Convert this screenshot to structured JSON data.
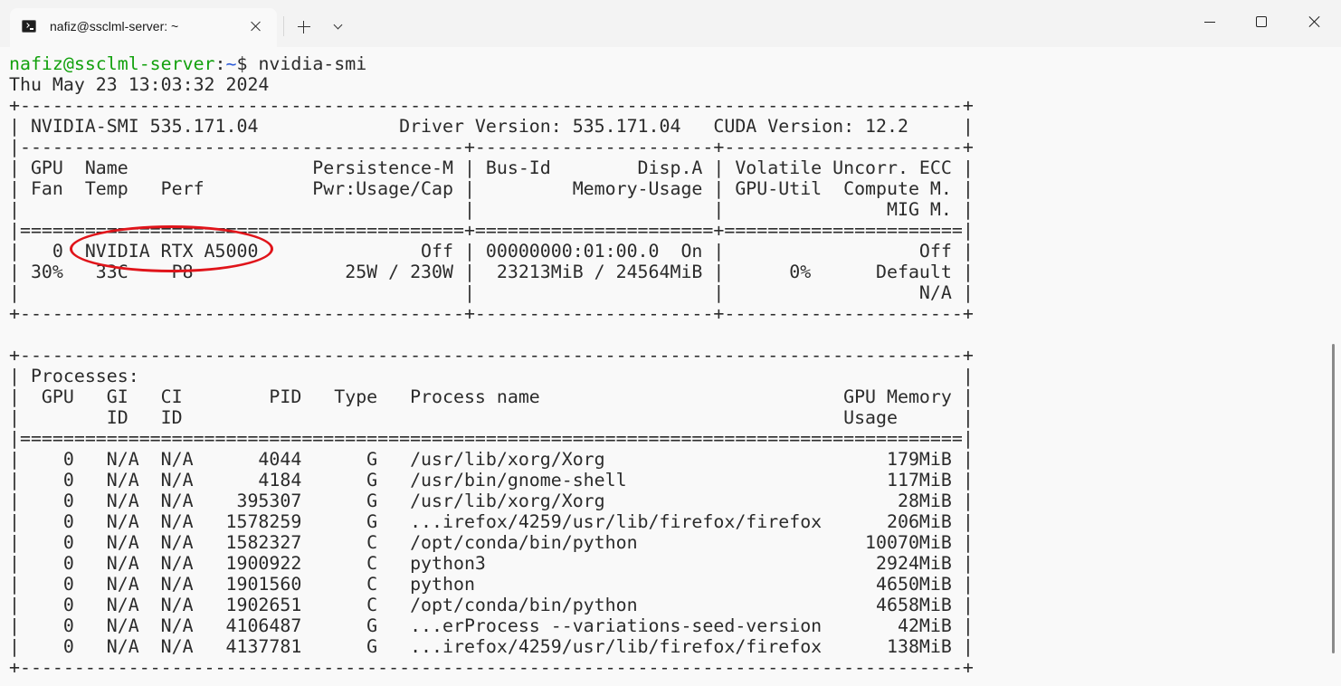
{
  "window": {
    "tab_title": "nafiz@ssclml-server: ~",
    "tab_icon": "terminal-icon"
  },
  "prompt": {
    "user_host": "nafiz@ssclml-server",
    "separator": ":",
    "path": "~",
    "symbol": "$",
    "command": " nvidia-smi"
  },
  "colors": {
    "background": "#f9f9f9",
    "text": "#2b2b2b",
    "prompt_user": "#13a10e",
    "prompt_path": "#2b5bd9",
    "highlight_ellipse": "#e0141a"
  },
  "output_lines": [
    "Thu May 23 13:03:32 2024",
    "+---------------------------------------------------------------------------------------+",
    "| NVIDIA-SMI 535.171.04             Driver Version: 535.171.04   CUDA Version: 12.2     |",
    "|-----------------------------------------+----------------------+----------------------+",
    "| GPU  Name                 Persistence-M | Bus-Id        Disp.A | Volatile Uncorr. ECC |",
    "| Fan  Temp   Perf          Pwr:Usage/Cap |         Memory-Usage | GPU-Util  Compute M. |",
    "|                                         |                      |               MIG M. |",
    "|=========================================+======================+======================|",
    "|   0  NVIDIA RTX A5000               Off | 00000000:01:00.0  On |                  Off |",
    "| 30%   33C    P8              25W / 230W |  23213MiB / 24564MiB |      0%      Default |",
    "|                                         |                      |                  N/A |",
    "+-----------------------------------------+----------------------+----------------------+",
    "",
    "+---------------------------------------------------------------------------------------+",
    "| Processes:                                                                            |",
    "|  GPU   GI   CI        PID   Type   Process name                            GPU Memory |",
    "|        ID   ID                                                             Usage      |",
    "|=======================================================================================|",
    "|    0   N/A  N/A      4044      G   /usr/lib/xorg/Xorg                          179MiB |",
    "|    0   N/A  N/A      4184      G   /usr/bin/gnome-shell                        117MiB |",
    "|    0   N/A  N/A    395307      G   /usr/lib/xorg/Xorg                           28MiB |",
    "|    0   N/A  N/A   1578259      G   ...irefox/4259/usr/lib/firefox/firefox      206MiB |",
    "|    0   N/A  N/A   1582327      C   /opt/conda/bin/python                     10070MiB |",
    "|    0   N/A  N/A   1900922      C   python3                                    2924MiB |",
    "|    0   N/A  N/A   1901560      C   python                                     4650MiB |",
    "|    0   N/A  N/A   1902651      C   /opt/conda/bin/python                      4658MiB |",
    "|    0   N/A  N/A   4106487      G   ...erProcess --variations-seed-version       42MiB |",
    "|    0   N/A  N/A   4137781      G   ...irefox/4259/usr/lib/firefox/firefox      138MiB |",
    "+---------------------------------------------------------------------------------------+"
  ]
}
